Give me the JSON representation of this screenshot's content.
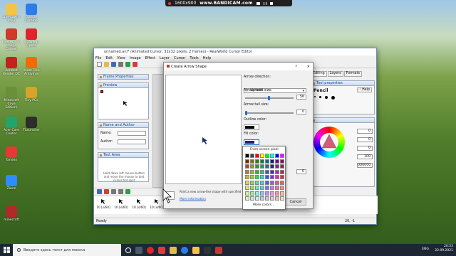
{
  "bandicam": {
    "resolution": "1600x900",
    "url": "www.BANDICAM.com"
  },
  "desktop_icons": [
    {
      "label": "для сайта sany",
      "color": "#f4c542"
    },
    {
      "label": "Google Chrome",
      "color": "#2b7de9"
    },
    {
      "label": "Free PDF to Image Conver",
      "color": "#d03a2c"
    },
    {
      "label": "Браузер Opera",
      "color": "#e0242b"
    },
    {
      "label": "Acrobat Reader DC",
      "color": "#c5221f"
    },
    {
      "label": "Avast Free Antivirus",
      "color": "#ef6c00"
    },
    {
      "label": "Minecraft (Java Edition)",
      "color": "#6b8f3a"
    },
    {
      "label": "Tiny PCs",
      "color": "#d7a328"
    },
    {
      "label": "Acer Care Center",
      "color": "#24a36a"
    },
    {
      "label": "TLauncher",
      "color": "#2d2d2d"
    },
    {
      "label": "Yandex",
      "color": "#e53935"
    },
    {
      "label": "Zoom",
      "color": "#2d8cff"
    },
    {
      "label": "minecraft",
      "color": "#b02a2a"
    }
  ],
  "app": {
    "title": "unnamed.ani* (Animated Cursor, 32x32 pixels, 2 frames) - RealWorld Cursor Editor",
    "menu": [
      "File",
      "Edit",
      "View",
      "Image",
      "Effect",
      "Layer",
      "Cursor",
      "Tools",
      "Help"
    ],
    "frame_properties": "Frame Properties",
    "preview": "Preview",
    "name_author": "Name and Author",
    "name_label": "Name:",
    "author_label": "Author:",
    "text_area": "Text Area",
    "hint": "Hold down left mouse button and move the mouse to test cursor hot spot",
    "tabs": [
      "Editing",
      "Layers",
      "Formats"
    ],
    "tool_properties": "Tool properties",
    "pencil": "Pencil",
    "help": "Help",
    "frames": [
      "10 [s/60]",
      "10 [s/60]",
      "10 [s/60]",
      "10 [s/60]",
      "10 [s/60]",
      "10 [s/60]"
    ],
    "status_left": "Ready",
    "status_right": "20, -1",
    "color_values": [
      "0",
      "0",
      "0",
      "100",
      "000000"
    ]
  },
  "dialog": {
    "title": "Create Arrow Shape",
    "help_glyph": "?",
    "close_glyph": "✕",
    "arrow_direction_label": "Arrow direction:",
    "arrow_direction_value": "\\ - Up-left",
    "arrow_head_label": "Arrow head size:",
    "arrow_head_value": "56",
    "arrow_tail_label": "Arrow tail size:",
    "arrow_tail_value": "0",
    "outline_color_label": "Outline color:",
    "fill_color_label": "Fill color:",
    "extra_value": "0",
    "footer_text": "Paint a new arrow-like shape with specified param...",
    "more_info": "More information",
    "cancel": "Cancel"
  },
  "palette": {
    "from_screen": "From screen pixel",
    "more_colors": "More colors..."
  },
  "taskbar": {
    "search_placeholder": "Введите здесь текст для поиска",
    "lang": "ENG",
    "time": "20:53",
    "date": "22.09.2021"
  }
}
